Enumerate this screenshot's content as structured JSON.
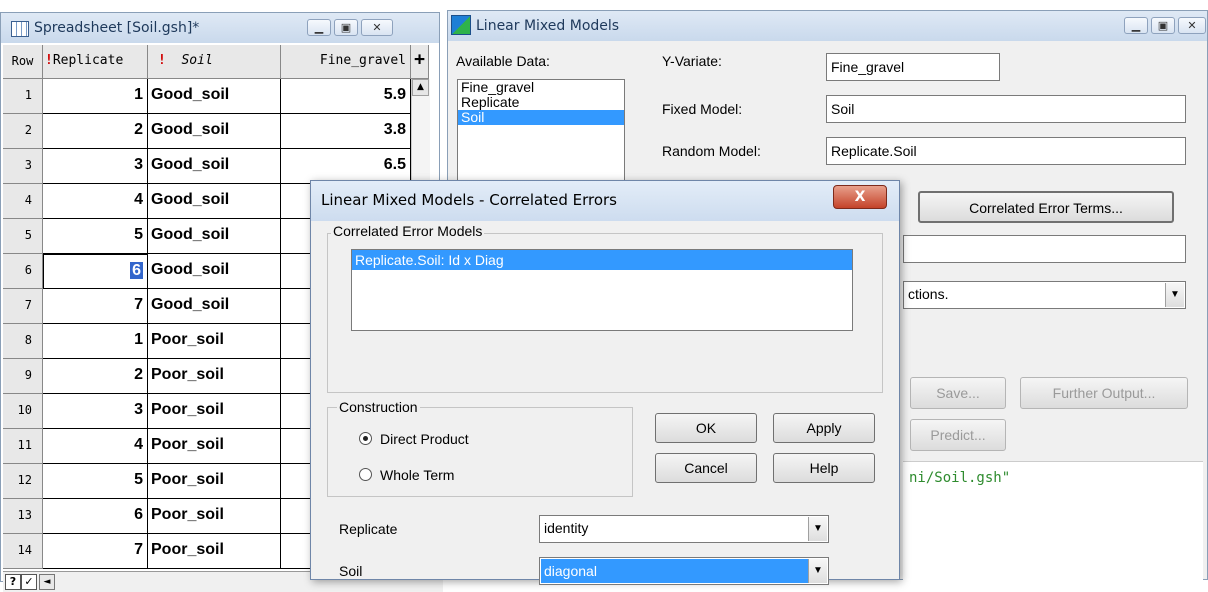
{
  "spreadsheet": {
    "title": "Spreadsheet [Soil.gsh]*",
    "col_headers": {
      "row": "Row",
      "replicate": "Replicate",
      "soil": "Soil",
      "fine_gravel": "Fine_gravel",
      "add": "+"
    },
    "rows": [
      {
        "row": "1",
        "replicate": "1",
        "soil": "Good_soil",
        "fine_gravel": "5.9"
      },
      {
        "row": "2",
        "replicate": "2",
        "soil": "Good_soil",
        "fine_gravel": "3.8"
      },
      {
        "row": "3",
        "replicate": "3",
        "soil": "Good_soil",
        "fine_gravel": "6.5"
      },
      {
        "row": "4",
        "replicate": "4",
        "soil": "Good_soil",
        "fine_gravel": ""
      },
      {
        "row": "5",
        "replicate": "5",
        "soil": "Good_soil",
        "fine_gravel": ""
      },
      {
        "row": "6",
        "replicate": "6",
        "soil": "Good_soil",
        "fine_gravel": ""
      },
      {
        "row": "7",
        "replicate": "7",
        "soil": "Good_soil",
        "fine_gravel": ""
      },
      {
        "row": "8",
        "replicate": "1",
        "soil": "Poor_soil",
        "fine_gravel": ""
      },
      {
        "row": "9",
        "replicate": "2",
        "soil": "Poor_soil",
        "fine_gravel": ""
      },
      {
        "row": "10",
        "replicate": "3",
        "soil": "Poor_soil",
        "fine_gravel": ""
      },
      {
        "row": "11",
        "replicate": "4",
        "soil": "Poor_soil",
        "fine_gravel": ""
      },
      {
        "row": "12",
        "replicate": "5",
        "soil": "Poor_soil",
        "fine_gravel": ""
      },
      {
        "row": "13",
        "replicate": "6",
        "soil": "Poor_soil",
        "fine_gravel": ""
      },
      {
        "row": "14",
        "replicate": "7",
        "soil": "Poor_soil",
        "fine_gravel": ""
      }
    ],
    "status_glyphs": {
      "help": "?",
      "check": "✓",
      "left": "◄"
    }
  },
  "lmm": {
    "title": "Linear Mixed Models",
    "available_data_label": "Available Data:",
    "available_data": [
      "Fine_gravel",
      "Replicate",
      "Soil"
    ],
    "y_variate_label": "Y-Variate:",
    "y_variate_value": "Fine_gravel",
    "fixed_model_label": "Fixed Model:",
    "fixed_model_value": "Soil",
    "random_model_label": "Random Model:",
    "random_model_value": "Replicate.Soil",
    "correlated_error_button": "Correlated Error Terms...",
    "options_combo_value": "ctions.",
    "save_button": "Save...",
    "further_output_button": "Further Output...",
    "predict_button": "Predict...",
    "output_text": "ni/Soil.gsh\""
  },
  "dialog": {
    "title": "Linear Mixed Models - Correlated Errors",
    "close_glyph": "X",
    "cem_group_label": "Correlated Error Models",
    "cem_items": [
      "Replicate.Soil:  Id x Diag"
    ],
    "construction_label": "Construction",
    "direct_product_label": "Direct Product",
    "whole_term_label": "Whole Term",
    "ok_label": "OK",
    "apply_label": "Apply",
    "cancel_label": "Cancel",
    "help_label": "Help",
    "replicate_label": "Replicate",
    "replicate_value": "identity",
    "soil_label": "Soil",
    "soil_value": "diagonal"
  }
}
